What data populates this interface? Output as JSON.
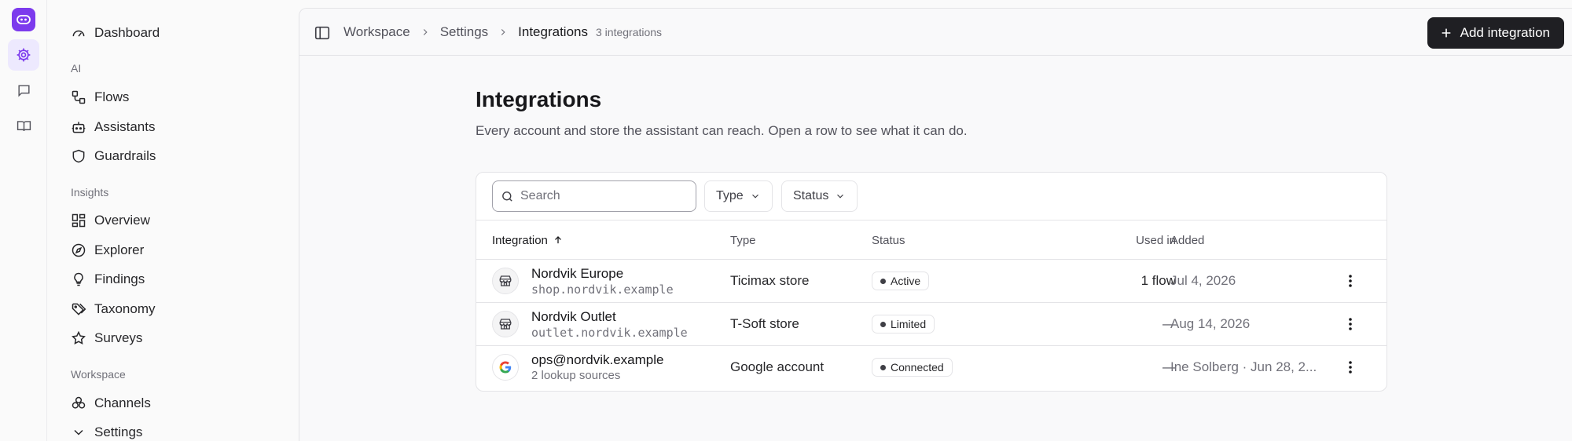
{
  "sidebar": {
    "dashboard": "Dashboard",
    "sections": [
      {
        "heading": "AI",
        "items": [
          "Flows",
          "Assistants",
          "Guardrails"
        ]
      },
      {
        "heading": "Insights",
        "items": [
          "Overview",
          "Explorer",
          "Findings",
          "Taxonomy",
          "Surveys"
        ]
      },
      {
        "heading": "Workspace",
        "items": [
          "Channels",
          "Settings"
        ]
      }
    ]
  },
  "topbar": {
    "breadcrumb": [
      "Workspace",
      "Settings",
      "Integrations"
    ],
    "count": "3 integrations",
    "add_button": "Add integration"
  },
  "page": {
    "title": "Integrations",
    "subtitle": "Every account and store the assistant can reach. Open a row to see what it can do."
  },
  "toolbar": {
    "search_placeholder": "Search",
    "filters": [
      "Type",
      "Status"
    ]
  },
  "table": {
    "columns": [
      "Integration",
      "Type",
      "Status",
      "Used in",
      "Added"
    ],
    "rows": [
      {
        "icon": "store-icon",
        "name": "Nordvik Europe",
        "sub": "shop.nordvik.example",
        "type": "Ticimax store",
        "status": "Active",
        "used_in": "1 flow",
        "added": "Jul 4, 2026"
      },
      {
        "icon": "store-icon",
        "name": "Nordvik Outlet",
        "sub": "outlet.nordvik.example",
        "type": "T-Soft store",
        "status": "Limited",
        "used_in": "—",
        "added": "Aug 14, 2026"
      },
      {
        "icon": "google-icon",
        "name": "ops@nordvik.example",
        "sub": "2 lookup sources",
        "type": "Google account",
        "status": "Connected",
        "used_in": "—",
        "added": "Ine Solberg · Jun 28, 2..."
      }
    ]
  },
  "colors": {
    "brand": "#7c3aed",
    "primary_button": "#1f1f23"
  }
}
